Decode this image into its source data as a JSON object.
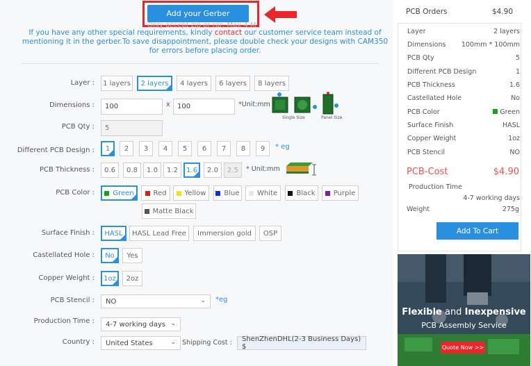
{
  "top": {
    "gerber_button": "Add your Gerber",
    "accept_text": "Only accept zip or rar, Max 4 M",
    "notice_pre": "If you have any other special requirements, kindly ",
    "notice_link": "contact",
    "notice_post": " our customer service team instead of mentioning it in the gerber.To save disappointment, please double check your designs with CAM350 for errors before placing order."
  },
  "form": {
    "layer": {
      "label": "Layer :",
      "options": [
        "1 layers",
        "2 layers",
        "4 layers",
        "6 layers",
        "8 layers"
      ],
      "selected": "2 layers"
    },
    "dimensions": {
      "label": "Dimensions :",
      "width": "100",
      "x": "x",
      "height": "100",
      "unit": "*Unit:mm",
      "single_size": "Single Size",
      "panel_size": "Panel Size"
    },
    "qty": {
      "label": "PCB Qty :",
      "value": "5"
    },
    "design": {
      "label": "Different PCB Design :",
      "options": [
        "1",
        "2",
        "3",
        "4",
        "5",
        "6",
        "7",
        "8",
        "9"
      ],
      "selected": "1",
      "note": "* eg"
    },
    "thickness": {
      "label": "PCB Thickness :",
      "options": [
        "0.6",
        "0.8",
        "1.0",
        "1.2",
        "1.6",
        "2.0",
        "2.5"
      ],
      "selected": "1.6",
      "disabled": "2.5",
      "unit": "* Unit:mm"
    },
    "color": {
      "label": "PCB Color :",
      "options": [
        {
          "name": "Green",
          "swatch": "#1aa21a"
        },
        {
          "name": "Red",
          "swatch": "#e01b1b"
        },
        {
          "name": "Yellow",
          "swatch": "#f2e21a"
        },
        {
          "name": "Blue",
          "swatch": "#1431c8"
        },
        {
          "name": "White",
          "swatch": "#e6e6e6"
        },
        {
          "name": "Black",
          "swatch": "#111111"
        },
        {
          "name": "Purple",
          "swatch": "#7b1fa2"
        },
        {
          "name": "Matte Black",
          "swatch": "#555555"
        }
      ],
      "selected": "Green"
    },
    "finish": {
      "label": "Surface Finish :",
      "options": [
        "HASL",
        "HASL Lead Free",
        "Immersion gold",
        "OSP"
      ],
      "selected": "HASL"
    },
    "castellated": {
      "label": "Castellated Hole :",
      "options": [
        "No",
        "Yes"
      ],
      "selected": "No"
    },
    "copper": {
      "label": "Copper Weight :",
      "options": [
        "1oz",
        "2oz"
      ],
      "selected": "1oz"
    },
    "stencil": {
      "label": "PCB Stencil :",
      "value": "NO",
      "note": "*eg"
    },
    "production": {
      "label": "Production Time :",
      "value": "4-7 working days"
    },
    "country": {
      "label": "Country :",
      "value": "United States",
      "shipping_label": "Shipping Cost :",
      "shipping_value": "ShenZhenDHL(2-3 Business Days) $"
    }
  },
  "orders": {
    "title": "PCB Orders",
    "total": "$4.90",
    "rows": [
      {
        "k": "Layer",
        "v": "2 layers"
      },
      {
        "k": "Dimensions",
        "v": "100mm * 100mm"
      },
      {
        "k": "PCB Qty",
        "v": "5"
      },
      {
        "k": "Different PCB Design",
        "v": "1"
      },
      {
        "k": "PCB Thickness",
        "v": "1.6"
      },
      {
        "k": "Castellated Hole",
        "v": "No"
      },
      {
        "k": "PCB Color",
        "v": "Green"
      },
      {
        "k": "Surface Finish",
        "v": "HASL"
      },
      {
        "k": "Copper Weight",
        "v": "1oz"
      },
      {
        "k": "PCB Stencil",
        "v": "NO"
      }
    ],
    "cost_label": "PCB-Cost",
    "cost_value": "$4.90",
    "production_label": "Production Time",
    "production_value": "4-7 working days",
    "weight_label": "Weight",
    "weight_value": "275g",
    "cart_button": "Add To Cart"
  },
  "banner": {
    "line1_a": "Flexible",
    "line1_b": " and ",
    "line1_c": "Inexpensive",
    "line2": "PCB Assembly Service",
    "button": "Quote Now >>"
  },
  "colors": {
    "accent": "#2a8fdf",
    "alert": "#e8262b",
    "cost": "#f05050"
  }
}
